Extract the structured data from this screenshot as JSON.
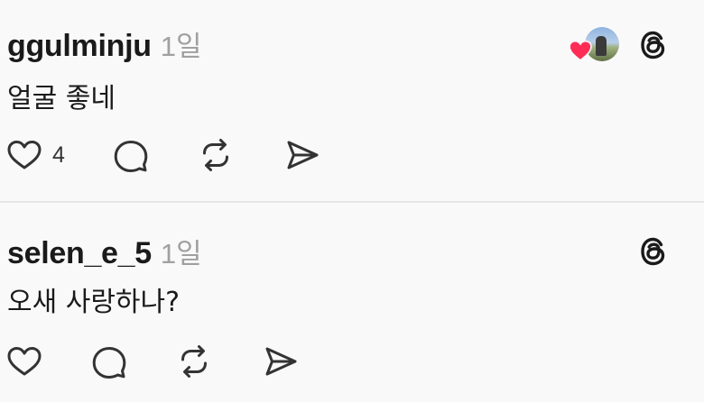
{
  "comments": [
    {
      "username": "ggulminju",
      "time": "1일",
      "text": "얼굴 좋네",
      "like_count": "4",
      "liked_by_author": true
    },
    {
      "username": "selen_e_5",
      "time": "1일",
      "text": "오새 사랑하나?",
      "liked_by_author": false
    }
  ],
  "colors": {
    "background": "#f9f9f9",
    "text": "#1a1a1a",
    "secondary_text": "#a0a0a0",
    "heart_red": "#ff2d55",
    "divider": "#e6e6e6"
  },
  "icons": {
    "like": "heart-outline-icon",
    "reply": "speech-bubble-icon",
    "repost": "repost-icon",
    "share": "send-icon",
    "brand": "threads-logo-icon",
    "liked_badge": "red-heart-icon"
  }
}
